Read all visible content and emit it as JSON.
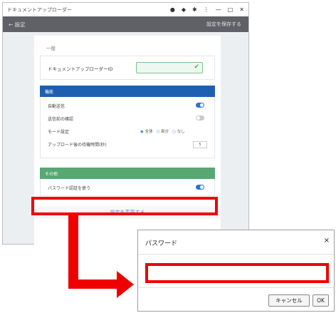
{
  "window": {
    "title": "ドキュメントアップローダー",
    "controls": [
      "●",
      "◆",
      "✱",
      "⋮",
      "—",
      "□",
      "✕"
    ]
  },
  "header": {
    "back_label": "← 設定",
    "right_label": "設定を保存する"
  },
  "sections": {
    "general_label": "一般",
    "id_label": "ドキュメントアップローダーID",
    "id_value": "",
    "panel1_title": "機能",
    "panel1_rows": {
      "row1": "自動送信",
      "row2": "送信前の確認",
      "row3": "モード設定",
      "row4": "アップロード後の待機時間(秒)",
      "radio_options": [
        "全体",
        "部分",
        "なし"
      ],
      "stepper_value": "5"
    },
    "panel2_title": "その他",
    "panel2_rows": {
      "row1": "パスワード認証を使う"
    },
    "apply_label": "設定を変更する"
  },
  "dialog": {
    "title": "パスワード",
    "close": "×",
    "password_value": "",
    "cancel_label": "キャンセル",
    "ok_label": "OK"
  },
  "colors": {
    "highlight": "#f00000",
    "blue_panel": "#1f5fb0",
    "green_panel": "#57a872",
    "toggle_on": "#2a74d8"
  }
}
